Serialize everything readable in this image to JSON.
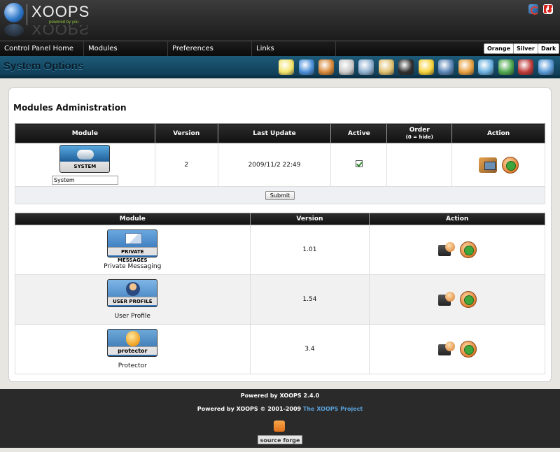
{
  "header": {
    "logo_text": "XOOPS",
    "logo_subtitle": "powered by you"
  },
  "nav": {
    "items": [
      "Control Panel Home",
      "Modules",
      "Preferences",
      "Links"
    ],
    "themes": [
      "Orange",
      "Silver",
      "Dark"
    ]
  },
  "system_bar": {
    "title": "System Options",
    "tool_icons": [
      {
        "name": "blocks-icon",
        "color": "#f3e36a"
      },
      {
        "name": "modules-icon",
        "color": "#4a8fd8"
      },
      {
        "name": "groups-icon",
        "color": "#d98a3a"
      },
      {
        "name": "images-icon",
        "color": "#c9c9c9"
      },
      {
        "name": "find-users-icon",
        "color": "#8fb0d0"
      },
      {
        "name": "edit-users-icon",
        "color": "#e0c070"
      },
      {
        "name": "ranks-icon",
        "color": "#303030"
      },
      {
        "name": "smilies-icon",
        "color": "#f7d23a"
      },
      {
        "name": "banners-icon",
        "color": "#5b86b8"
      },
      {
        "name": "comments-icon",
        "color": "#e8a040"
      },
      {
        "name": "mail-users-icon",
        "color": "#6ab0e0"
      },
      {
        "name": "avatars-icon",
        "color": "#4fa84f"
      },
      {
        "name": "templates-icon",
        "color": "#c03a3a"
      },
      {
        "name": "preferences-icon",
        "color": "#5a9ad8"
      }
    ]
  },
  "page": {
    "heading": "Modules Administration"
  },
  "installed_table": {
    "headers": {
      "module": "Module",
      "version": "Version",
      "last_update": "Last Update",
      "active": "Active",
      "order": "Order",
      "order_hint": "(0 = hide)",
      "action": "Action"
    },
    "rows": [
      {
        "badge_label": "SYSTEM",
        "name_value": "System",
        "version": "2",
        "last_update": "2009/11/2 22:49",
        "active": true
      }
    ],
    "submit_label": "Submit"
  },
  "available_table": {
    "headers": {
      "module": "Module",
      "version": "Version",
      "action": "Action"
    },
    "rows": [
      {
        "badge_label": "PRIVATE MESSAGES",
        "name": "Private Messaging",
        "version": "1.01"
      },
      {
        "badge_label": "USER PROFILE",
        "name": "User Profile",
        "version": "1.54"
      },
      {
        "badge_label": "protector",
        "name": "Protector",
        "version": "3.4"
      }
    ]
  },
  "footer": {
    "line1": "Powered by XOOPS 2.4.0",
    "line2_prefix": "Powered by XOOPS © 2001-2009",
    "line2_link": "The XOOPS Project",
    "badge_label": "source forge"
  }
}
